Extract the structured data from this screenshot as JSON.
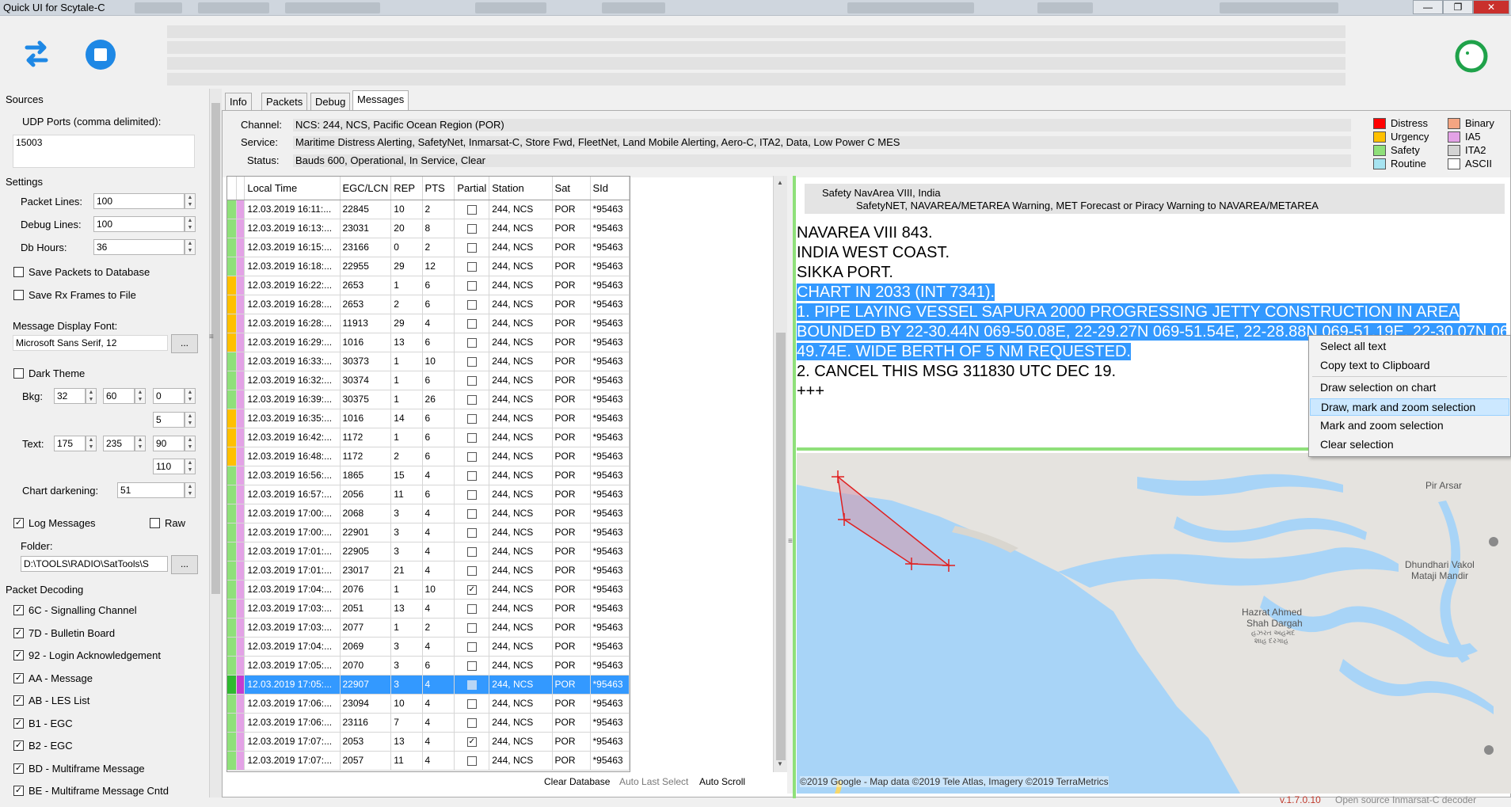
{
  "window": {
    "title": "Quick UI for Scytale-C"
  },
  "left": {
    "sources_label": "Sources",
    "udp_label": "UDP Ports (comma delimited):",
    "udp_value": "15003",
    "settings_label": "Settings",
    "packet_lines_label": "Packet Lines:",
    "packet_lines_value": "100",
    "debug_lines_label": "Debug Lines:",
    "debug_lines_value": "100",
    "db_hours_label": "Db Hours:",
    "db_hours_value": "36",
    "save_packets_label": "Save Packets to Database",
    "save_rx_label": "Save Rx Frames to File",
    "font_label": "Message Display Font:",
    "font_value": "Microsoft Sans Serif, 12",
    "font_button": "...",
    "dark_theme_label": "Dark Theme",
    "bkg_label": "Bkg:",
    "bkg_values": [
      "32",
      "60",
      "0",
      "5"
    ],
    "text_label": "Text:",
    "text_values": [
      "175",
      "235",
      "90",
      "110"
    ],
    "chart_darkening_label": "Chart darkening:",
    "chart_darkening_value": "51",
    "log_messages_label": "Log Messages",
    "raw_label": "Raw",
    "folder_label": "Folder:",
    "folder_value": "D:\\TOOLS\\RADIO\\SatTools\\S",
    "folder_button": "...",
    "packet_decoding_label": "Packet Decoding",
    "decoding": [
      {
        "label": "6C - Signalling Channel",
        "checked": true
      },
      {
        "label": "7D - Bulletin Board",
        "checked": true
      },
      {
        "label": "92 - Login Acknowledgement",
        "checked": true
      },
      {
        "label": "AA - Message",
        "checked": true
      },
      {
        "label": "AB - LES List",
        "checked": true
      },
      {
        "label": "B1 - EGC",
        "checked": true
      },
      {
        "label": "B2 - EGC",
        "checked": true
      },
      {
        "label": "BD - Multiframe Message",
        "checked": true
      },
      {
        "label": "BE - Multiframe Message Cntd",
        "checked": true
      }
    ]
  },
  "tabs": [
    {
      "label": "Info",
      "active": false
    },
    {
      "label": "Packets",
      "active": false
    },
    {
      "label": "Debug",
      "active": false
    },
    {
      "label": "Messages",
      "active": true
    }
  ],
  "info": {
    "channel_label": "Channel:",
    "channel_value": "NCS: 244, NCS, Pacific Ocean Region (POR)",
    "service_label": "Service:",
    "service_value": "Maritime Distress Alerting, SafetyNet, Inmarsat-C, Store Fwd, FleetNet, Land Mobile Alerting, Aero-C, ITA2, Data, Low Power C MES",
    "status_label": "Status:",
    "status_value": "Bauds 600, Operational, In Service, Clear"
  },
  "legend": [
    {
      "label": "Distress",
      "color": "#ff0000"
    },
    {
      "label": "Urgency",
      "color": "#ffc000"
    },
    {
      "label": "Safety",
      "color": "#8fe07a"
    },
    {
      "label": "Routine",
      "color": "#a6e3f0"
    },
    {
      "label": "Binary",
      "color": "#f4a582"
    },
    {
      "label": "IA5",
      "color": "#e3a2e6"
    },
    {
      "label": "ITA2",
      "color": "#d3d3d3"
    },
    {
      "label": "ASCII",
      "color": "#ffffff"
    }
  ],
  "grid": {
    "headers": [
      "Local Time",
      "EGC/LCN",
      "REP",
      "PTS",
      "Partial",
      "Station",
      "Sat",
      "SId"
    ],
    "rows": [
      {
        "time": "12.03.2019 16:11:...",
        "egc": "22845",
        "rep": "10",
        "pts": "2",
        "partial": false,
        "station": "244, NCS",
        "sat": "POR",
        "sid": "*95463",
        "prio": "#8fe07a",
        "type": "#e3a2e6"
      },
      {
        "time": "12.03.2019 16:13:...",
        "egc": "23031",
        "rep": "20",
        "pts": "8",
        "partial": false,
        "station": "244, NCS",
        "sat": "POR",
        "sid": "*95463",
        "prio": "#8fe07a",
        "type": "#e3a2e6"
      },
      {
        "time": "12.03.2019 16:15:...",
        "egc": "23166",
        "rep": "0",
        "pts": "2",
        "partial": false,
        "station": "244, NCS",
        "sat": "POR",
        "sid": "*95463",
        "prio": "#8fe07a",
        "type": "#e3a2e6"
      },
      {
        "time": "12.03.2019 16:18:...",
        "egc": "22955",
        "rep": "29",
        "pts": "12",
        "partial": false,
        "station": "244, NCS",
        "sat": "POR",
        "sid": "*95463",
        "prio": "#8fe07a",
        "type": "#e3a2e6"
      },
      {
        "time": "12.03.2019 16:22:...",
        "egc": "2653",
        "rep": "1",
        "pts": "6",
        "partial": false,
        "station": "244, NCS",
        "sat": "POR",
        "sid": "*95463",
        "prio": "#ffc000",
        "type": "#e3a2e6"
      },
      {
        "time": "12.03.2019 16:28:...",
        "egc": "2653",
        "rep": "2",
        "pts": "6",
        "partial": false,
        "station": "244, NCS",
        "sat": "POR",
        "sid": "*95463",
        "prio": "#ffc000",
        "type": "#e3a2e6"
      },
      {
        "time": "12.03.2019 16:28:...",
        "egc": "11913",
        "rep": "29",
        "pts": "4",
        "partial": false,
        "station": "244, NCS",
        "sat": "POR",
        "sid": "*95463",
        "prio": "#ffc000",
        "type": "#e3a2e6"
      },
      {
        "time": "12.03.2019 16:29:...",
        "egc": "1016",
        "rep": "13",
        "pts": "6",
        "partial": false,
        "station": "244, NCS",
        "sat": "POR",
        "sid": "*95463",
        "prio": "#ffc000",
        "type": "#e3a2e6"
      },
      {
        "time": "12.03.2019 16:33:...",
        "egc": "30373",
        "rep": "1",
        "pts": "10",
        "partial": false,
        "station": "244, NCS",
        "sat": "POR",
        "sid": "*95463",
        "prio": "#8fe07a",
        "type": "#e3a2e6"
      },
      {
        "time": "12.03.2019 16:32:...",
        "egc": "30374",
        "rep": "1",
        "pts": "6",
        "partial": false,
        "station": "244, NCS",
        "sat": "POR",
        "sid": "*95463",
        "prio": "#8fe07a",
        "type": "#e3a2e6"
      },
      {
        "time": "12.03.2019 16:39:...",
        "egc": "30375",
        "rep": "1",
        "pts": "26",
        "partial": false,
        "station": "244, NCS",
        "sat": "POR",
        "sid": "*95463",
        "prio": "#8fe07a",
        "type": "#e3a2e6"
      },
      {
        "time": "12.03.2019 16:35:...",
        "egc": "1016",
        "rep": "14",
        "pts": "6",
        "partial": false,
        "station": "244, NCS",
        "sat": "POR",
        "sid": "*95463",
        "prio": "#ffc000",
        "type": "#e3a2e6"
      },
      {
        "time": "12.03.2019 16:42:...",
        "egc": "1172",
        "rep": "1",
        "pts": "6",
        "partial": false,
        "station": "244, NCS",
        "sat": "POR",
        "sid": "*95463",
        "prio": "#ffc000",
        "type": "#e3a2e6"
      },
      {
        "time": "12.03.2019 16:48:...",
        "egc": "1172",
        "rep": "2",
        "pts": "6",
        "partial": false,
        "station": "244, NCS",
        "sat": "POR",
        "sid": "*95463",
        "prio": "#ffc000",
        "type": "#e3a2e6"
      },
      {
        "time": "12.03.2019 16:56:...",
        "egc": "1865",
        "rep": "15",
        "pts": "4",
        "partial": false,
        "station": "244, NCS",
        "sat": "POR",
        "sid": "*95463",
        "prio": "#8fe07a",
        "type": "#e3a2e6"
      },
      {
        "time": "12.03.2019 16:57:...",
        "egc": "2056",
        "rep": "11",
        "pts": "6",
        "partial": false,
        "station": "244, NCS",
        "sat": "POR",
        "sid": "*95463",
        "prio": "#8fe07a",
        "type": "#e3a2e6"
      },
      {
        "time": "12.03.2019 17:00:...",
        "egc": "2068",
        "rep": "3",
        "pts": "4",
        "partial": false,
        "station": "244, NCS",
        "sat": "POR",
        "sid": "*95463",
        "prio": "#8fe07a",
        "type": "#e3a2e6"
      },
      {
        "time": "12.03.2019 17:00:...",
        "egc": "22901",
        "rep": "3",
        "pts": "4",
        "partial": false,
        "station": "244, NCS",
        "sat": "POR",
        "sid": "*95463",
        "prio": "#8fe07a",
        "type": "#e3a2e6"
      },
      {
        "time": "12.03.2019 17:01:...",
        "egc": "22905",
        "rep": "3",
        "pts": "4",
        "partial": false,
        "station": "244, NCS",
        "sat": "POR",
        "sid": "*95463",
        "prio": "#8fe07a",
        "type": "#e3a2e6"
      },
      {
        "time": "12.03.2019 17:01:...",
        "egc": "23017",
        "rep": "21",
        "pts": "4",
        "partial": false,
        "station": "244, NCS",
        "sat": "POR",
        "sid": "*95463",
        "prio": "#8fe07a",
        "type": "#e3a2e6"
      },
      {
        "time": "12.03.2019 17:04:...",
        "egc": "2076",
        "rep": "1",
        "pts": "10",
        "partial": true,
        "station": "244, NCS",
        "sat": "POR",
        "sid": "*95463",
        "prio": "#8fe07a",
        "type": "#e3a2e6"
      },
      {
        "time": "12.03.2019 17:03:...",
        "egc": "2051",
        "rep": "13",
        "pts": "4",
        "partial": false,
        "station": "244, NCS",
        "sat": "POR",
        "sid": "*95463",
        "prio": "#8fe07a",
        "type": "#e3a2e6"
      },
      {
        "time": "12.03.2019 17:03:...",
        "egc": "2077",
        "rep": "1",
        "pts": "2",
        "partial": false,
        "station": "244, NCS",
        "sat": "POR",
        "sid": "*95463",
        "prio": "#8fe07a",
        "type": "#e3a2e6"
      },
      {
        "time": "12.03.2019 17:04:...",
        "egc": "2069",
        "rep": "3",
        "pts": "4",
        "partial": false,
        "station": "244, NCS",
        "sat": "POR",
        "sid": "*95463",
        "prio": "#8fe07a",
        "type": "#e3a2e6"
      },
      {
        "time": "12.03.2019 17:05:...",
        "egc": "2070",
        "rep": "3",
        "pts": "6",
        "partial": false,
        "station": "244, NCS",
        "sat": "POR",
        "sid": "*95463",
        "prio": "#8fe07a",
        "type": "#e3a2e6"
      },
      {
        "time": "12.03.2019 17:05:...",
        "egc": "22907",
        "rep": "3",
        "pts": "4",
        "partial": false,
        "station": "244, NCS",
        "sat": "POR",
        "sid": "*95463",
        "prio": "#2fb82f",
        "type": "#c23cd0",
        "selected": true
      },
      {
        "time": "12.03.2019 17:06:...",
        "egc": "23094",
        "rep": "10",
        "pts": "4",
        "partial": false,
        "station": "244, NCS",
        "sat": "POR",
        "sid": "*95463",
        "prio": "#8fe07a",
        "type": "#e3a2e6"
      },
      {
        "time": "12.03.2019 17:06:...",
        "egc": "23116",
        "rep": "7",
        "pts": "4",
        "partial": false,
        "station": "244, NCS",
        "sat": "POR",
        "sid": "*95463",
        "prio": "#8fe07a",
        "type": "#e3a2e6"
      },
      {
        "time": "12.03.2019 17:07:...",
        "egc": "2053",
        "rep": "13",
        "pts": "4",
        "partial": true,
        "station": "244, NCS",
        "sat": "POR",
        "sid": "*95463",
        "prio": "#8fe07a",
        "type": "#e3a2e6"
      },
      {
        "time": "12.03.2019 17:07:...",
        "egc": "2057",
        "rep": "11",
        "pts": "4",
        "partial": false,
        "station": "244, NCS",
        "sat": "POR",
        "sid": "*95463",
        "prio": "#8fe07a",
        "type": "#e3a2e6"
      }
    ]
  },
  "grid_footer": {
    "clear_db": "Clear Database",
    "auto_last_select": "Auto Last Select",
    "auto_scroll": "Auto Scroll"
  },
  "message": {
    "header_line1": "Safety NavArea VIII, India",
    "header_line2": "SafetyNET, NAVAREA/METAREA Warning, MET Forecast or Piracy Warning to NAVAREA/METAREA",
    "lines": [
      {
        "text": "NAVAREA VIII 843.",
        "hl": false
      },
      {
        "text": "INDIA WEST COAST.",
        "hl": false
      },
      {
        "text": "SIKKA PORT.",
        "hl": false
      },
      {
        "text": "CHART IN 2033 (INT 7341).",
        "hl": true
      },
      {
        "text": "1. PIPE LAYING VESSEL SAPURA 2000 PROGRESSING JETTY CONSTRUCTION IN AREA",
        "hl": true
      },
      {
        "text": "BOUNDED BY 22-30.44N 069-50.08E, 22-29.27N 069-51.54E, 22-28.88N 069-51.19E, 22-30.07N 069-",
        "hl": true
      },
      {
        "text": "49.74E. WIDE BERTH OF 5 NM REQUESTED.",
        "hl": true,
        "partial": true
      },
      {
        "text": "2. CANCEL THIS MSG 311830 UTC DEC 19.",
        "hl": false
      },
      {
        "text": "+++",
        "hl": false
      }
    ]
  },
  "context_menu": {
    "items": [
      {
        "label": "Select all text",
        "hover": false
      },
      {
        "label": "Copy text to Clipboard",
        "hover": false
      },
      {
        "label": "Draw selection on chart",
        "hover": false
      },
      {
        "label": "Draw, mark and zoom selection",
        "hover": true
      },
      {
        "label": "Mark and zoom selection",
        "hover": false
      },
      {
        "label": "Clear selection",
        "hover": false
      }
    ]
  },
  "map": {
    "labels": {
      "pir": "Pir Arsar",
      "dhundhari1": "Dhundhari Vakol",
      "dhundhari2": "Mataji Mandir",
      "hazrat1": "Hazrat Ahmed",
      "hazrat2": "Shah Dargah",
      "hazrat3": "હઝરત અહમદ",
      "hazrat4": "શાહ દરગાહ"
    },
    "copyright": "©2019 Google - Map data ©2019 Tele Atlas, Imagery ©2019 TerraMetrics"
  },
  "footer": {
    "version": "v.1.7.0.10",
    "tagline": "Open source Inmarsat-C decoder"
  },
  "colors": {
    "accent_select": "#3399ff",
    "water": "#a8d4f7",
    "land": "#e5e3df",
    "polygon_stroke": "#e02020"
  }
}
